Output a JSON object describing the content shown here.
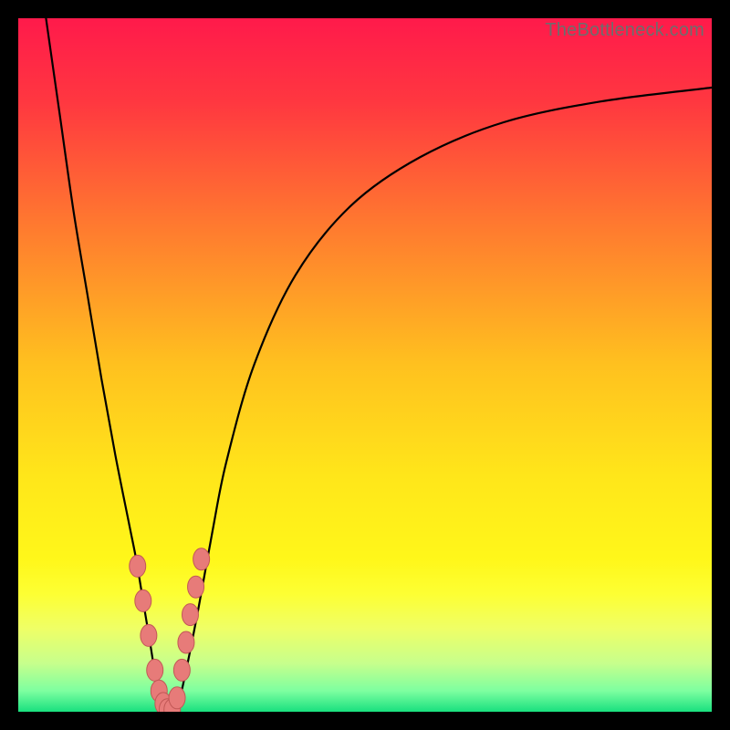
{
  "watermark": "TheBottleneck.com",
  "colors": {
    "frame": "#000000",
    "curve_stroke": "#000000",
    "marker_fill": "#e77b79",
    "marker_stroke": "#c25856",
    "gradient_stops": [
      {
        "offset": 0.0,
        "color": "#ff1a4b"
      },
      {
        "offset": 0.12,
        "color": "#ff3740"
      },
      {
        "offset": 0.3,
        "color": "#ff7a2f"
      },
      {
        "offset": 0.5,
        "color": "#ffc11f"
      },
      {
        "offset": 0.66,
        "color": "#ffe61a"
      },
      {
        "offset": 0.78,
        "color": "#fff71a"
      },
      {
        "offset": 0.83,
        "color": "#fdff33"
      },
      {
        "offset": 0.88,
        "color": "#efff66"
      },
      {
        "offset": 0.93,
        "color": "#c7ff8c"
      },
      {
        "offset": 0.97,
        "color": "#7dffa0"
      },
      {
        "offset": 1.0,
        "color": "#19e07f"
      }
    ]
  },
  "chart_data": {
    "type": "line",
    "title": "",
    "xlabel": "",
    "ylabel": "",
    "xlim": [
      0,
      100
    ],
    "ylim": [
      0,
      100
    ],
    "grid": false,
    "legend": false,
    "series": [
      {
        "name": "curve",
        "x": [
          4,
          6,
          8,
          10,
          12,
          14,
          16,
          17,
          18,
          19,
          20,
          21,
          22,
          23,
          24,
          26,
          28,
          30,
          34,
          40,
          48,
          58,
          70,
          84,
          100
        ],
        "values": [
          100,
          86,
          72,
          60,
          48,
          37,
          27,
          22,
          16,
          10,
          4,
          1,
          0,
          1,
          5,
          15,
          26,
          36,
          50,
          63,
          73,
          80,
          85,
          88,
          90
        ]
      }
    ],
    "markers": {
      "name": "highlighted-points",
      "x": [
        17.2,
        18.0,
        18.8,
        19.7,
        20.3,
        20.9,
        21.5,
        22.2,
        22.9,
        23.6,
        24.2,
        24.8,
        25.6,
        26.4
      ],
      "values": [
        21.0,
        16.0,
        11.0,
        6.0,
        3.0,
        1.2,
        0.3,
        0.3,
        2.0,
        6.0,
        10.0,
        14.0,
        18.0,
        22.0
      ]
    }
  }
}
